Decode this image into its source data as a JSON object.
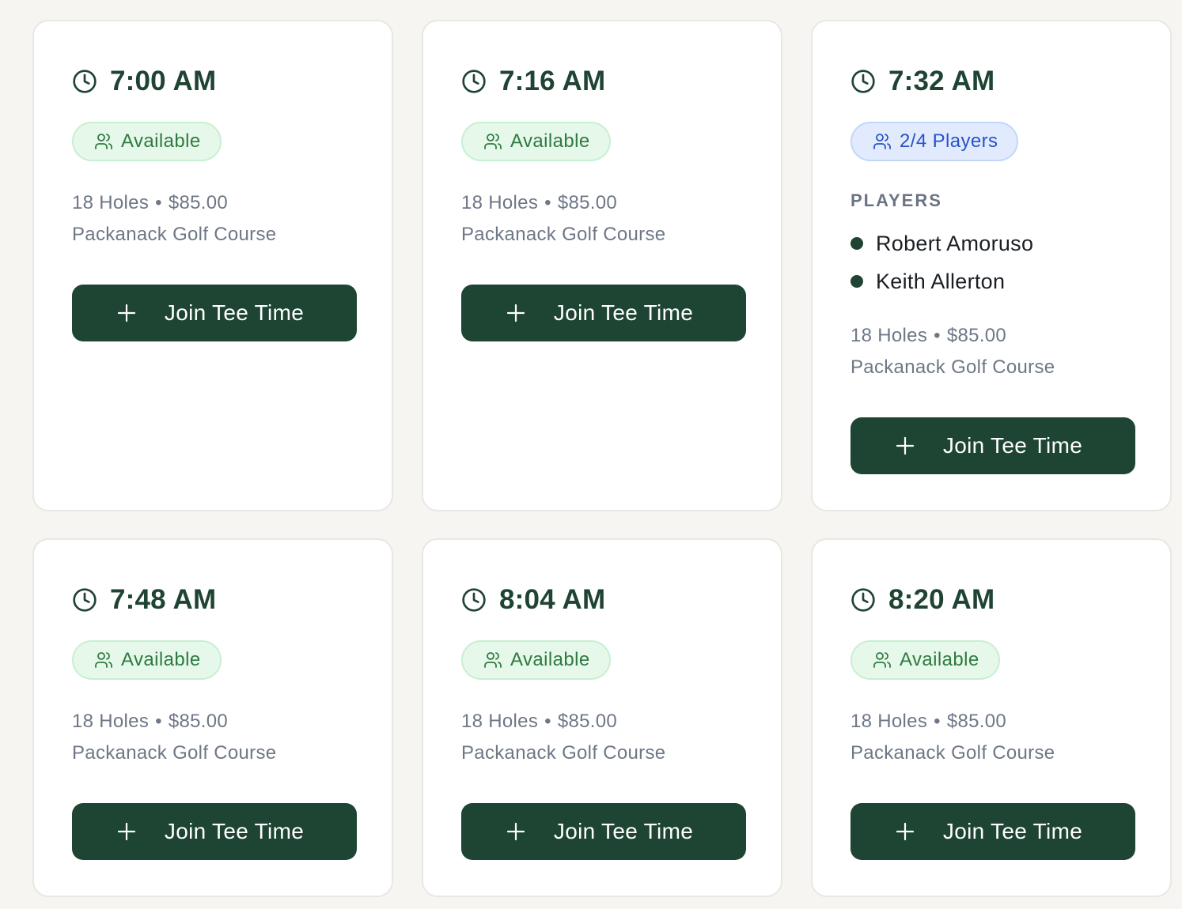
{
  "colors": {
    "page_bg": "#f6f5f1",
    "primary": "#1e4533",
    "available_text": "#2f7a41",
    "players_text": "#2a52c9",
    "muted_text": "#6e7786"
  },
  "tee_times": [
    {
      "time": "7:00 AM",
      "status": "Available",
      "status_kind": "available",
      "holes": "18 Holes",
      "separator": "•",
      "price": "$85.00",
      "course": "Packanack Golf Course",
      "button_label": "Join Tee Time"
    },
    {
      "time": "7:16 AM",
      "status": "Available",
      "status_kind": "available",
      "holes": "18 Holes",
      "separator": "•",
      "price": "$85.00",
      "course": "Packanack Golf Course",
      "button_label": "Join Tee Time"
    },
    {
      "time": "7:32 AM",
      "status": "2/4 Players",
      "status_kind": "players",
      "players_label": "PLAYERS",
      "players": [
        "Robert Amoruso",
        "Keith Allerton"
      ],
      "holes": "18 Holes",
      "separator": "•",
      "price": "$85.00",
      "course": "Packanack Golf Course",
      "button_label": "Join Tee Time"
    },
    {
      "time": "7:48 AM",
      "status": "Available",
      "status_kind": "available",
      "holes": "18 Holes",
      "separator": "•",
      "price": "$85.00",
      "course": "Packanack Golf Course",
      "button_label": "Join Tee Time"
    },
    {
      "time": "8:04 AM",
      "status": "Available",
      "status_kind": "available",
      "holes": "18 Holes",
      "separator": "•",
      "price": "$85.00",
      "course": "Packanack Golf Course",
      "button_label": "Join Tee Time"
    },
    {
      "time": "8:20 AM",
      "status": "Available",
      "status_kind": "available",
      "holes": "18 Holes",
      "separator": "•",
      "price": "$85.00",
      "course": "Packanack Golf Course",
      "button_label": "Join Tee Time"
    }
  ]
}
